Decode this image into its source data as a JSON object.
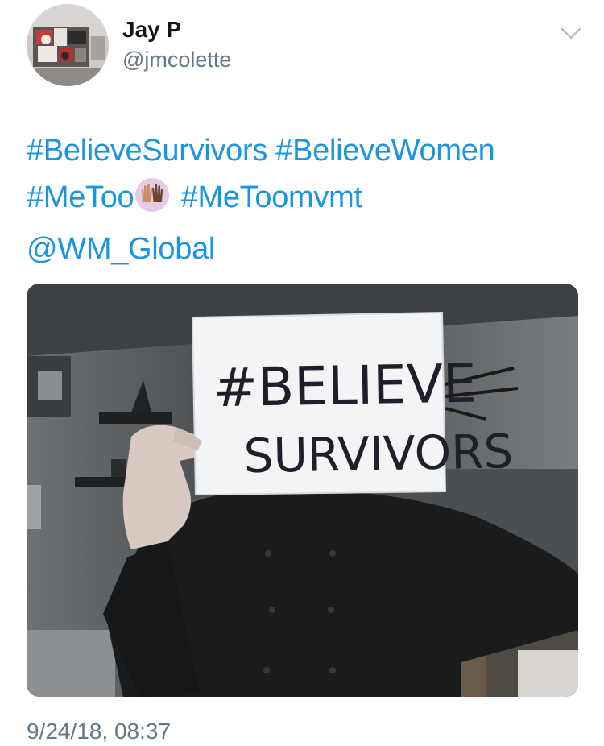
{
  "user": {
    "display_name": "Jay P",
    "handle": "@jmcolette"
  },
  "tweet": {
    "lines": [
      [
        "#BelieveSurvivors",
        "#BelieveWomen"
      ],
      [
        "#MeToo",
        "#MeToomvmt"
      ],
      [
        "@WM_Global"
      ]
    ],
    "emoji": "raised-hands-emoji",
    "sign_line1": "#BELIEVE",
    "sign_line2": "SURVIVORS",
    "timestamp": "9/24/18, 08:37"
  },
  "colors": {
    "link": "#1b95e0",
    "secondary": "#657786",
    "name": "#14171a"
  },
  "icons": {
    "menu": "chevron-down-icon"
  }
}
